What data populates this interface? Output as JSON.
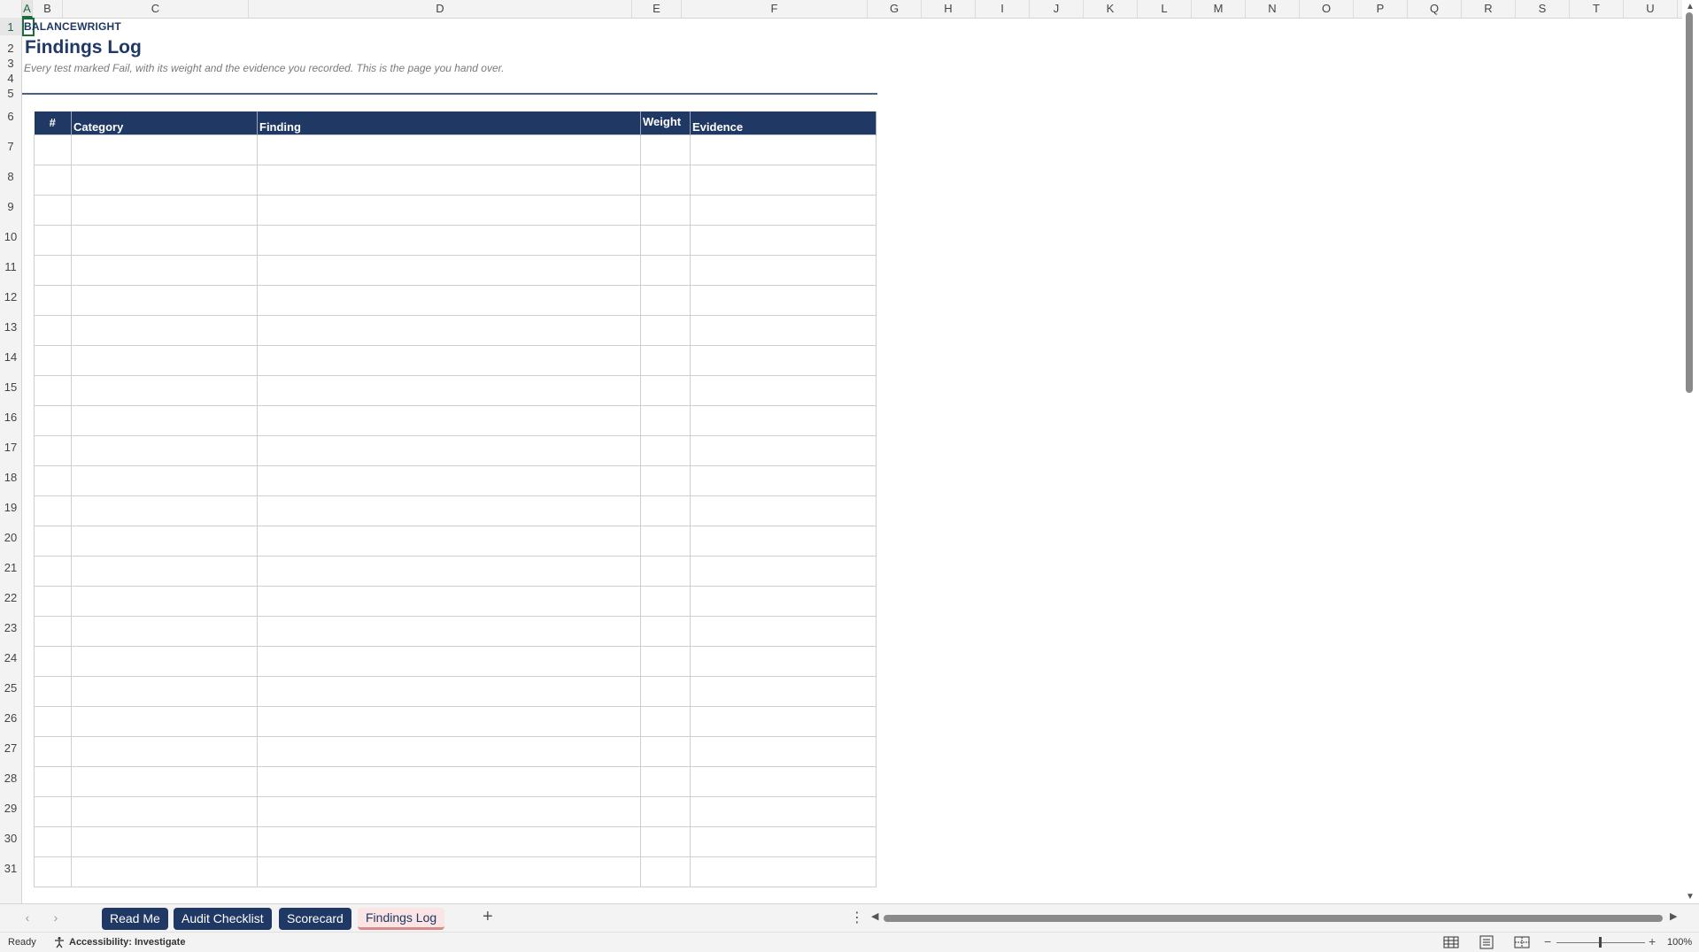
{
  "columns": [
    "A",
    "B",
    "C",
    "D",
    "E",
    "F",
    "G",
    "H",
    "I",
    "J",
    "K",
    "L",
    "M",
    "N",
    "O",
    "P",
    "Q",
    "R",
    "S",
    "T",
    "U"
  ],
  "active_column": "A",
  "rows": [
    "1",
    "2",
    "3",
    "4",
    "5",
    "6",
    "7",
    "8",
    "9",
    "10",
    "11",
    "12",
    "13",
    "14",
    "15",
    "16",
    "17",
    "18",
    "19",
    "20",
    "21",
    "22",
    "23",
    "24",
    "25",
    "26",
    "27",
    "28",
    "29",
    "30",
    "31"
  ],
  "active_row": "1",
  "sheet": {
    "brand": "BALANCEWRIGHT",
    "title": "Findings Log",
    "subtitle": "Every test marked Fail, with its weight and the evidence you recorded. This is the page you hand over."
  },
  "table": {
    "headers": [
      "#",
      "Category",
      "Finding",
      "Weight",
      "Evidence"
    ],
    "empty_rows": 25
  },
  "tabs": [
    {
      "label": "Read Me",
      "active": false
    },
    {
      "label": "Audit Checklist",
      "active": false
    },
    {
      "label": "Scorecard",
      "active": false
    },
    {
      "label": "Findings Log",
      "active": true
    }
  ],
  "status": {
    "ready": "Ready",
    "accessibility": "Accessibility: Investigate",
    "zoom": "100%"
  },
  "colors": {
    "header_navy": "#1f3864",
    "active_tab_bg": "#fbe4e4",
    "selection_green": "#1e6b3c"
  },
  "icons": [
    "chevron-left-icon",
    "chevron-right-icon",
    "plus-icon",
    "more-options-icon",
    "accessibility-icon",
    "normal-view-icon",
    "page-layout-icon",
    "page-break-icon"
  ]
}
